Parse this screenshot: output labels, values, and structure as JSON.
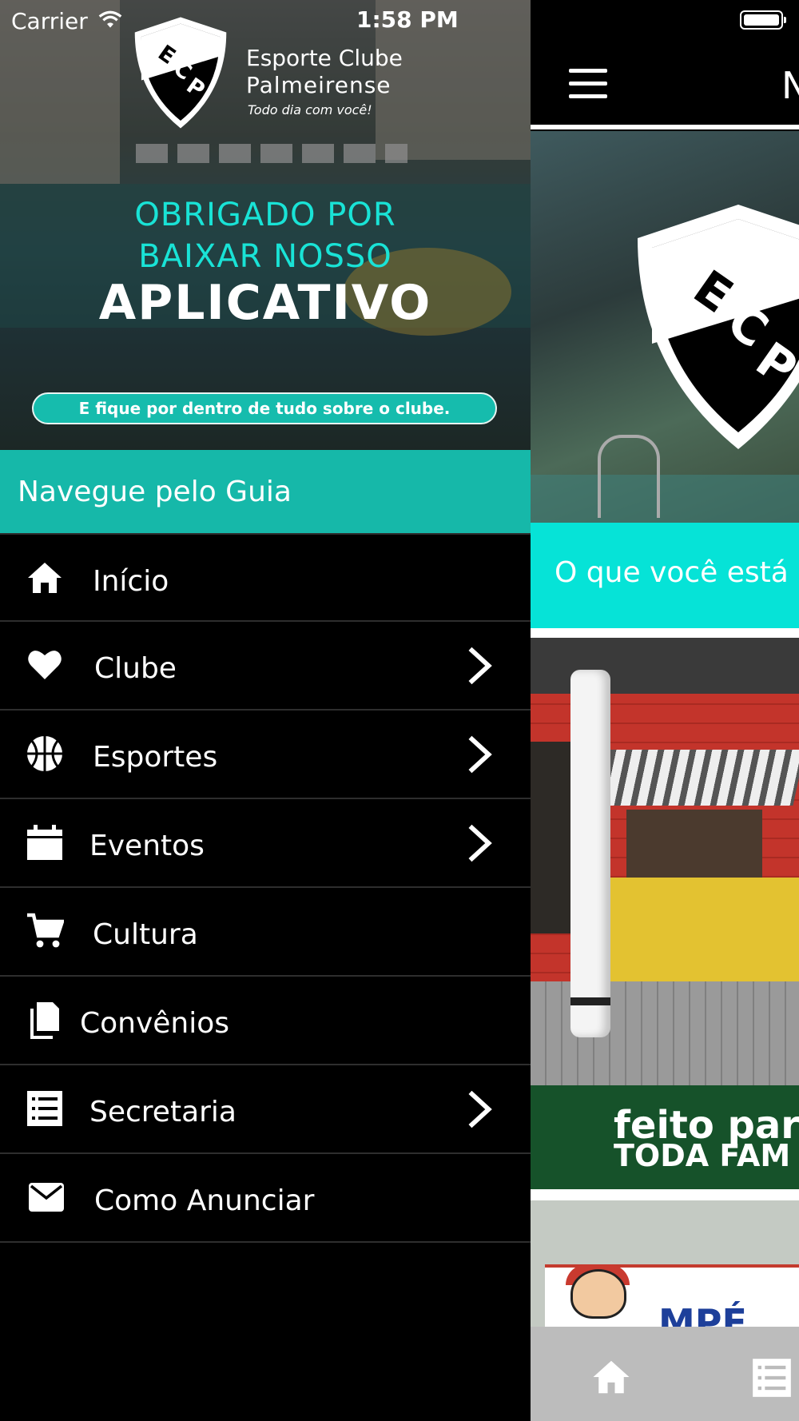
{
  "status_bar": {
    "carrier": "Carrier",
    "time": "1:58 PM"
  },
  "drawer": {
    "banner": {
      "club_name_line1": "Esporte Clube",
      "club_name_line2": "Palmeirense",
      "tagline": "Todo dia com você!",
      "message_line1": "OBRIGADO POR",
      "message_line2": "BAIXAR NOSSO",
      "message_line3": "APLICATIVO",
      "pill_text": "E fique por dentro de tudo sobre o clube."
    },
    "guide_title": "Navegue pelo Guia",
    "items": [
      {
        "label": "Início",
        "icon": "home-icon",
        "has_submenu": false
      },
      {
        "label": "Clube",
        "icon": "heart-icon",
        "has_submenu": true
      },
      {
        "label": "Esportes",
        "icon": "basketball-icon",
        "has_submenu": true
      },
      {
        "label": "Eventos",
        "icon": "calendar-icon",
        "has_submenu": true
      },
      {
        "label": "Cultura",
        "icon": "cart-icon",
        "has_submenu": false
      },
      {
        "label": "Convênios",
        "icon": "document-icon",
        "has_submenu": false
      },
      {
        "label": "Secretaria",
        "icon": "list-icon",
        "has_submenu": true
      },
      {
        "label": "Como Anunciar",
        "icon": "mail-icon",
        "has_submenu": false
      }
    ]
  },
  "main": {
    "nav_title": "N",
    "search_prompt": "O que você está p",
    "green_banner_line1": "feito para",
    "green_banner_line2": "TODA FAM",
    "ad_text": "MPÉ",
    "tab_bar": [
      "home-icon",
      "list-icon"
    ]
  },
  "colors": {
    "teal_header": "#16b8a9",
    "aqua_search": "#06e3d7",
    "aqua_text": "#19e3d6",
    "green_banner": "#16522a",
    "tab_bar": "#bcbcbc"
  }
}
